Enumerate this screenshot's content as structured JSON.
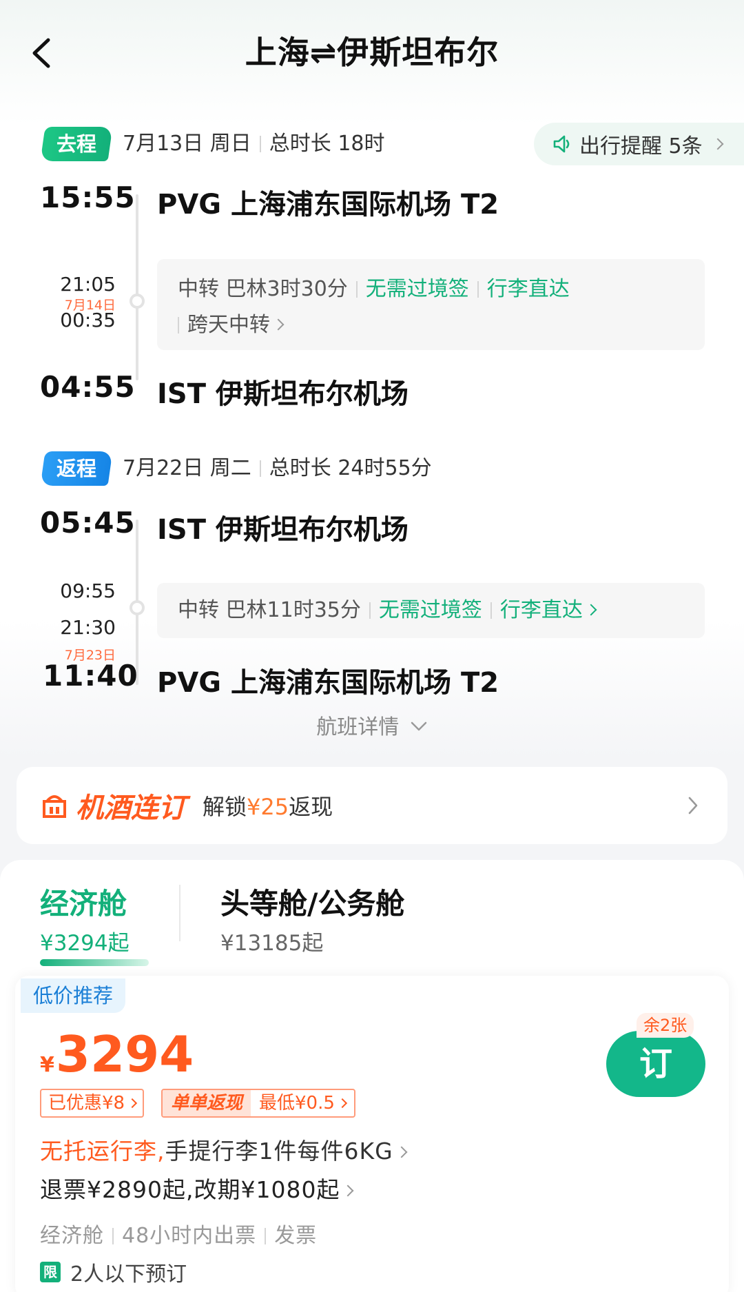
{
  "header": {
    "title": "上海⇌伊斯坦布尔"
  },
  "outbound": {
    "tag": "去程",
    "date": "7月13日 周日",
    "duration": "总时长 18时",
    "reminder": "出行提醒 5条",
    "dep_time": "15:55",
    "dep_airport": "PVG 上海浦东国际机场 T2",
    "transfer_arr": "21:05",
    "transfer_day": "7月14日",
    "transfer_dep": "00:35",
    "transfer_text": "中转 巴林3时30分",
    "transfer_visa": "无需过境签",
    "transfer_baggage": "行李直达",
    "transfer_overnight": "跨天中转",
    "arr_time": "04:55",
    "arr_airport": "IST 伊斯坦布尔机场"
  },
  "return": {
    "tag": "返程",
    "date": "7月22日 周二",
    "duration": "总时长 24时55分",
    "dep_time": "05:45",
    "dep_airport": "IST 伊斯坦布尔机场",
    "transfer_arr": "09:55",
    "transfer_dep": "21:30",
    "transfer_text": "中转 巴林11时35分",
    "transfer_visa": "无需过境签",
    "transfer_baggage": "行李直达",
    "arr_day": "7月23日",
    "arr_time": "11:40",
    "arr_airport": "PVG 上海浦东国际机场 T2"
  },
  "flight_detail": "航班详情",
  "hotel_banner": {
    "brand": "机酒连订",
    "promo_prefix": "解锁",
    "promo_amount": "¥25",
    "promo_suffix": "返现"
  },
  "cabins": [
    {
      "name": "经济舱",
      "price": "¥3294起"
    },
    {
      "name": "头等舱/公务舱",
      "price": "¥13185起"
    }
  ],
  "fare": {
    "badge": "低价推荐",
    "currency": "¥",
    "price": "3294",
    "discount": "已优惠¥8",
    "single_label": "单单返现",
    "single_value": "最低¥0.5",
    "baggage_none": "无托运行李,",
    "baggage_carry": "手提行李1件每件6KG",
    "refund": "退票¥2890起,改期¥1080起",
    "meta_cabin": "经济舱",
    "meta_ticket": "48小时内出票",
    "meta_invoice": "发票",
    "limit_icon": "限",
    "limit_text": "2人以下预订",
    "remaining": "余2张",
    "book": "订"
  },
  "colors": {
    "accent_green": "#13b07a",
    "accent_orange": "#ff5a1f",
    "accent_blue": "#1685e6"
  }
}
